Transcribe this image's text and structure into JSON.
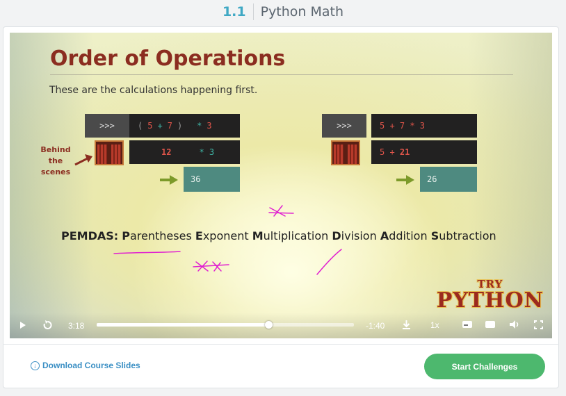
{
  "header": {
    "lesson_number": "1.1",
    "lesson_title": "Python Math"
  },
  "slide": {
    "title": "Order of Operations",
    "subtitle": "These are the calculations happening first.",
    "behind_label": [
      "Behind",
      "the",
      "scenes"
    ],
    "left_example": {
      "prompt": ">>>",
      "expression": [
        "(",
        "5",
        "+",
        "7",
        ")",
        "*",
        "3"
      ],
      "step_value": "12",
      "step_rest": "* 3",
      "result": "36"
    },
    "right_example": {
      "prompt": ">>>",
      "expression": "5 + 7 * 3",
      "step_left": "5 + ",
      "step_value": "21",
      "result": "26"
    },
    "pemdas": {
      "label": "PEMDAS:",
      "words": [
        {
          "first": "P",
          "rest": "arentheses"
        },
        {
          "first": "E",
          "rest": "xponent"
        },
        {
          "first": "M",
          "rest": "ultiplication"
        },
        {
          "first": "D",
          "rest": "ivision"
        },
        {
          "first": "A",
          "rest": "ddition"
        },
        {
          "first": "S",
          "rest": "ubtraction"
        }
      ]
    },
    "logo_top": "TRY",
    "logo_main": "PYTHON"
  },
  "player": {
    "elapsed": "3:18",
    "remaining": "-1:40",
    "progress_fraction": 0.667,
    "speed": "1x",
    "icons": [
      "play-icon",
      "replay-icon",
      "download-icon",
      "captions-icon",
      "hd-icon",
      "volume-icon",
      "fullscreen-icon"
    ]
  },
  "footer": {
    "download_label": "Download Course Slides",
    "start_label": "Start Challenges"
  },
  "colors": {
    "accent": "#3fa8c4",
    "start_button": "#4db86e",
    "slide_title": "#8b2d20",
    "ink": "#e01fd0"
  }
}
